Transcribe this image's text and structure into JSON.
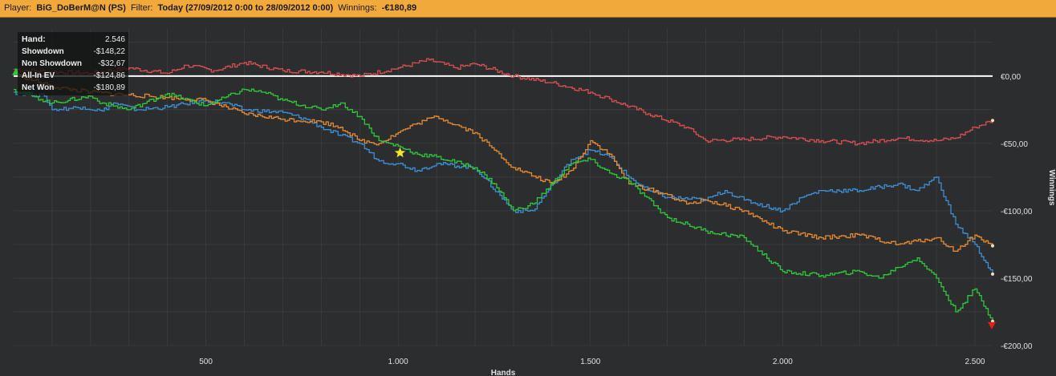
{
  "topbar": {
    "player_label": "Player:",
    "player_value": "BiG_DoBerM@N (PS)",
    "filter_label": "Filter:",
    "filter_value": "Today (27/09/2012 0:00 to 28/09/2012 0:00)",
    "winnings_label": "Winnings:",
    "winnings_value": "-€180,89"
  },
  "legend": [
    {
      "label": "Hand:",
      "value": "2.546"
    },
    {
      "label": "Showdown",
      "value": "-$148,22"
    },
    {
      "label": "Non Showdown",
      "value": "-$32,67"
    },
    {
      "label": "All-In EV",
      "value": "-$124,86"
    },
    {
      "label": "Net Won",
      "value": "-$180,89"
    }
  ],
  "colors": {
    "background": "#2b2d2f",
    "grid": "#4a4d50",
    "zero_line": "#ffffff",
    "showdown": "#3d8fd6",
    "non_showdown": "#d94f4f",
    "all_in_ev": "#e88a30",
    "net_won": "#2fc83a",
    "topbar": "#f2a93b"
  },
  "chart_data": {
    "type": "line",
    "xlabel": "Hands",
    "ylabel": "Winnings",
    "xlim": [
      0,
      2546
    ],
    "ylim": [
      -200,
      35
    ],
    "x_ticks": [
      {
        "value": 500,
        "label": "500"
      },
      {
        "value": 1000,
        "label": "1.000"
      },
      {
        "value": 1500,
        "label": "1.500"
      },
      {
        "value": 2000,
        "label": "2.000"
      },
      {
        "value": 2500,
        "label": "2.500"
      }
    ],
    "y_ticks": [
      {
        "value": 0,
        "label": "€0,00"
      },
      {
        "value": -50,
        "label": "-€50,00"
      },
      {
        "value": -100,
        "label": "-€100,00"
      },
      {
        "value": -150,
        "label": "-€150,00"
      },
      {
        "value": -200,
        "label": "-€200,00"
      }
    ],
    "grid": true,
    "star_marker": {
      "x": 1005,
      "y": -57
    },
    "series": [
      {
        "key": "non_showdown",
        "color": "#d94f4f",
        "x": [
          0,
          100,
          200,
          300,
          400,
          450,
          520,
          600,
          700,
          800,
          900,
          1000,
          1080,
          1150,
          1200,
          1300,
          1400,
          1500,
          1550,
          1650,
          1750,
          1800,
          1900,
          2000,
          2100,
          2200,
          2300,
          2400,
          2450,
          2500,
          2546
        ],
        "y": [
          5,
          3,
          2,
          6,
          2,
          8,
          4,
          10,
          4,
          3,
          0,
          6,
          12,
          6,
          9,
          0,
          -5,
          -12,
          -17,
          -28,
          -38,
          -48,
          -47,
          -45,
          -48,
          -50,
          -46,
          -48,
          -46,
          -38,
          -33
        ]
      },
      {
        "key": "showdown",
        "color": "#3d8fd6",
        "x": [
          0,
          80,
          100,
          180,
          230,
          260,
          320,
          400,
          500,
          550,
          600,
          700,
          760,
          800,
          850,
          900,
          950,
          1000,
          1050,
          1100,
          1200,
          1300,
          1350,
          1450,
          1500,
          1550,
          1600,
          1650,
          1700,
          1800,
          1850,
          1900,
          2000,
          2050,
          2100,
          2200,
          2300,
          2350,
          2400,
          2450,
          2500,
          2546
        ],
        "y": [
          -12,
          -15,
          -25,
          -23,
          -26,
          -20,
          -25,
          -23,
          -18,
          -20,
          -25,
          -27,
          -32,
          -38,
          -44,
          -50,
          -63,
          -65,
          -70,
          -65,
          -68,
          -100,
          -100,
          -62,
          -55,
          -60,
          -75,
          -85,
          -90,
          -92,
          -85,
          -92,
          -100,
          -90,
          -85,
          -85,
          -80,
          -85,
          -75,
          -110,
          -125,
          -147
        ]
      },
      {
        "key": "all_in_ev",
        "color": "#e88a30",
        "x": [
          0,
          100,
          200,
          300,
          400,
          500,
          600,
          700,
          800,
          850,
          900,
          950,
          1000,
          1050,
          1100,
          1200,
          1250,
          1300,
          1400,
          1450,
          1500,
          1550,
          1600,
          1700,
          1750,
          1800,
          1900,
          2000,
          2100,
          2200,
          2300,
          2400,
          2450,
          2500,
          2546
        ],
        "y": [
          2,
          -8,
          -12,
          -14,
          -16,
          -18,
          -28,
          -32,
          -34,
          -38,
          -48,
          -50,
          -42,
          -35,
          -30,
          -42,
          -55,
          -68,
          -80,
          -70,
          -48,
          -58,
          -80,
          -88,
          -95,
          -92,
          -100,
          -115,
          -120,
          -118,
          -125,
          -120,
          -130,
          -118,
          -126
        ]
      },
      {
        "key": "net_won",
        "color": "#2fc83a",
        "x": [
          0,
          100,
          200,
          230,
          300,
          400,
          500,
          600,
          650,
          700,
          800,
          850,
          900,
          950,
          1000,
          1050,
          1100,
          1200,
          1250,
          1300,
          1350,
          1450,
          1500,
          1550,
          1600,
          1700,
          1800,
          1900,
          2000,
          2100,
          2200,
          2250,
          2300,
          2350,
          2400,
          2450,
          2500,
          2546
        ],
        "y": [
          -10,
          -20,
          -15,
          -20,
          -25,
          -13,
          -22,
          -10,
          -12,
          -18,
          -25,
          -20,
          -30,
          -48,
          -52,
          -58,
          -60,
          -68,
          -80,
          -100,
          -95,
          -65,
          -62,
          -72,
          -78,
          -105,
          -115,
          -120,
          -145,
          -148,
          -145,
          -150,
          -142,
          -135,
          -150,
          -175,
          -158,
          -182
        ]
      }
    ]
  }
}
